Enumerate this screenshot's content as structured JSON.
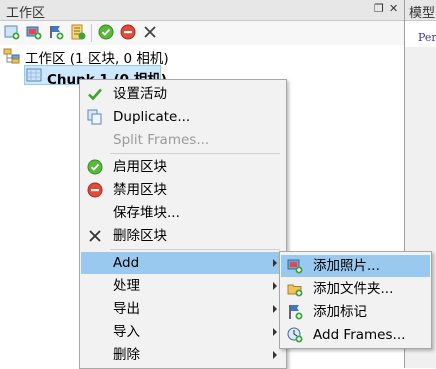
{
  "panel": {
    "title": "工作区"
  },
  "right_tab": {
    "title": "模型",
    "text": "Per"
  },
  "tree": {
    "root_label": "工作区 (1 区块, 0 相机)",
    "chunk_label": "Chunk 1 (0 相机)"
  },
  "context_menu": {
    "items": [
      {
        "label": "设置活动",
        "icon": "checkmark-icon"
      },
      {
        "label": "Duplicate...",
        "icon": "duplicate-icon"
      },
      {
        "label": "Split Frames...",
        "disabled": true
      },
      {
        "label": "启用区块",
        "icon": "enable-icon"
      },
      {
        "label": "禁用区块",
        "icon": "disable-icon"
      },
      {
        "label": "保存堆块..."
      },
      {
        "label": "删除区块",
        "icon": "delete-icon"
      },
      {
        "label": "Add",
        "submenu": true,
        "highlighted": true
      },
      {
        "label": "处理",
        "submenu": true
      },
      {
        "label": "导出",
        "submenu": true
      },
      {
        "label": "导入",
        "submenu": true
      },
      {
        "label": "删除",
        "submenu": true
      }
    ]
  },
  "add_submenu": {
    "items": [
      {
        "label": "添加照片...",
        "icon": "add-photos-icon",
        "highlighted": true
      },
      {
        "label": "添加文件夹...",
        "icon": "add-folder-icon"
      },
      {
        "label": "添加标记",
        "icon": "add-marker-icon"
      },
      {
        "label": "Add Frames...",
        "icon": "add-frames-icon"
      }
    ]
  },
  "colors": {
    "highlight": "#99c9ef",
    "menu_bg": "#f2f2f2",
    "chunk_select": "#cce8ff"
  }
}
